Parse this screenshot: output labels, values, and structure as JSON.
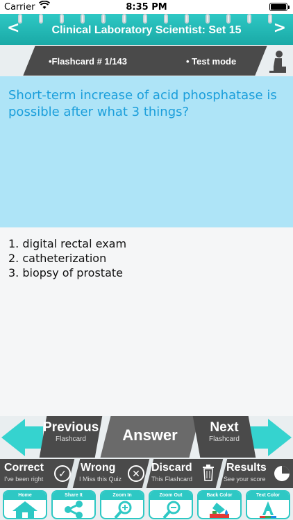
{
  "status_bar": {
    "carrier": "Carrier",
    "time": "8:35 PM"
  },
  "header": {
    "title": "Clinical Laboratory Scientist: Set 15",
    "back": "<",
    "forward": ">"
  },
  "info_bar": {
    "flashcard": "•Flashcard #  1/143",
    "mode": "• Test mode"
  },
  "question": {
    "text": "Short-term increase of acid phosphatase is possible after what 3 things?"
  },
  "answer": {
    "items": [
      "1. digital rectal exam",
      "2. catheterization",
      "3. biopsy of prostate"
    ]
  },
  "controls": {
    "previous": {
      "label": "Previous",
      "sub": "Flashcard"
    },
    "answer": {
      "label": "Answer"
    },
    "next": {
      "label": "Next",
      "sub": "Flashcard"
    }
  },
  "score": {
    "correct": {
      "label": "Correct",
      "sub": "I've been right"
    },
    "wrong": {
      "label": "Wrong",
      "sub": "I Miss this Quiz"
    },
    "discard": {
      "label": "Discard",
      "sub": "This Flashcard"
    },
    "results": {
      "label": "Results",
      "sub": "See your score"
    }
  },
  "tools": [
    {
      "label": "Home",
      "icon": "home-icon"
    },
    {
      "label": "Share It",
      "icon": "share-icon"
    },
    {
      "label": "Zoom In",
      "icon": "zoom-in-icon"
    },
    {
      "label": "Zoom Out",
      "icon": "zoom-out-icon"
    },
    {
      "label": "Back Color",
      "icon": "paint-bucket-icon"
    },
    {
      "label": "Text Color",
      "icon": "text-color-icon"
    }
  ],
  "colors": {
    "accent": "#2EC8C4",
    "question_bg": "#AEE4F7",
    "question_text": "#1A9EDB",
    "dark": "#4A4A4A"
  }
}
